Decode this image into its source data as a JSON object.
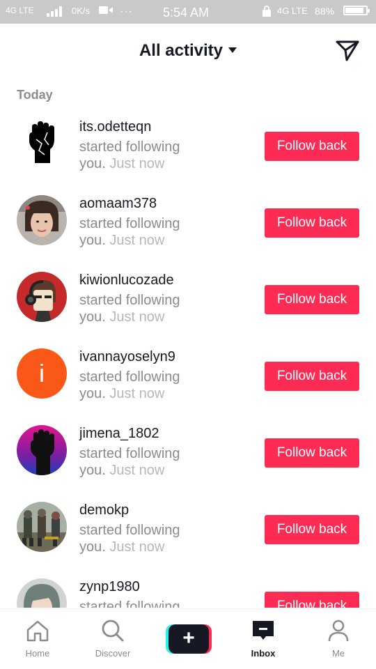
{
  "status_bar": {
    "network_left": "4G LTE",
    "speed": "0K/s",
    "dots": "···",
    "time": "5:54 AM",
    "network_right": "4G LTE",
    "battery": "88%",
    "battery_level": 0.88
  },
  "header": {
    "title": "All activity",
    "title_icon": "caret-down-icon",
    "action_icon": "send-icon"
  },
  "section_label": "Today",
  "colors": {
    "accent": "#fe2c55",
    "text_primary": "#161823",
    "text_secondary": "#8a8b91",
    "text_timestamp": "#b6b7ba"
  },
  "activity": [
    {
      "username": "its.odetteqn",
      "action": "started following you.",
      "time": "Just now",
      "button": "Follow back",
      "avatar": "raised-fist"
    },
    {
      "username": "aomaam378",
      "action": "started following you.",
      "time": "Just now",
      "button": "Follow back",
      "avatar": "girl-photo"
    },
    {
      "username": "kiwionlucozade",
      "action": "started following you.",
      "time": "Just now",
      "button": "Follow back",
      "avatar": "cartoon-headphones"
    },
    {
      "username": "ivannayoselyn9",
      "action": "started following you.",
      "time": "Just now",
      "button": "Follow back",
      "avatar": "letter",
      "avatar_letter": "i"
    },
    {
      "username": "jimena_1802",
      "action": "started following you.",
      "time": "Just now",
      "button": "Follow back",
      "avatar": "fist-gradient"
    },
    {
      "username": "demokp",
      "action": "started following you.",
      "time": "Just now",
      "button": "Follow back",
      "avatar": "game-soldiers"
    },
    {
      "username": "zynp1980",
      "action": "started following you.",
      "time": "",
      "button": "Follow back",
      "avatar": "woman-photo"
    }
  ],
  "bottom_nav": [
    {
      "label": "Home",
      "icon": "home-icon",
      "active": false
    },
    {
      "label": "Discover",
      "icon": "search-icon",
      "active": false
    },
    {
      "label": "",
      "icon": "plus-icon",
      "active": false
    },
    {
      "label": "Inbox",
      "icon": "inbox-icon",
      "active": true
    },
    {
      "label": "Me",
      "icon": "person-icon",
      "active": false
    }
  ]
}
